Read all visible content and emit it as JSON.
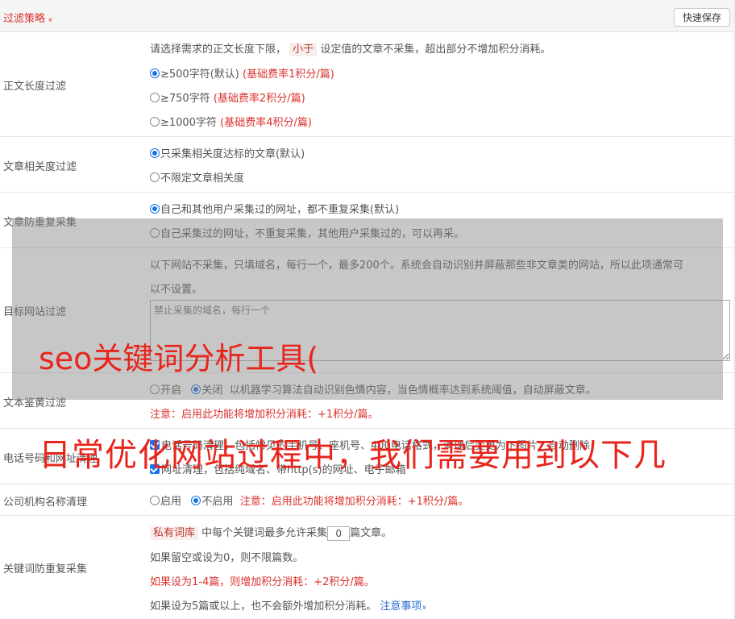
{
  "header": {
    "title": "过滤策略",
    "chevron": "»",
    "save_label": "快速保存"
  },
  "length_filter": {
    "label": "正文长度过滤",
    "desc_pre": "请选择需求的正文长度下限，",
    "desc_tag": "小于",
    "desc_post": "设定值的文章不采集，超出部分不增加积分消耗。",
    "options": [
      {
        "text": "≥500字符(默认)",
        "rate": "(基础费率1积分/篇)"
      },
      {
        "text": "≥750字符",
        "rate": "(基础费率2积分/篇)"
      },
      {
        "text": "≥1000字符",
        "rate": "(基础费率4积分/篇)"
      }
    ]
  },
  "relevance": {
    "label": "文章相关度过滤",
    "options": [
      "只采集相关度达标的文章(默认)",
      "不限定文章相关度"
    ]
  },
  "dedupe": {
    "label": "文章防重复采集",
    "options": [
      "自己和其他用户采集过的网址，都不重复采集(默认)",
      "自己采集过的网址，不重复采集，其他用户采集过的，可以再采。"
    ]
  },
  "site_filter": {
    "label": "目标网站过滤",
    "desc1": "以下网站不采集，只填域名，每行一个，最多200个。系统会自动识别并屏蔽那些非文章类的网站，所以此项通常可",
    "desc2": "以不设置。",
    "placeholder": "禁止采集的域名，每行一个"
  },
  "porn": {
    "label": "文本鉴黄过滤",
    "on": "开启",
    "off": "关闭",
    "desc": "以机器学习算法自动识别色情内容，当色情概率达到系统阈值，自动屏蔽文章。",
    "note": "注意：启用此功能将增加积分消耗：+1积分/篇。"
  },
  "phone": {
    "label": "电话号码和网址清理",
    "opt1": "电话号码清理，包括常见的手机号、座机号、400电话格式，清理后变更为下图片：自动删除",
    "opt2": "网址清理，包括纯域名、带http(s)的网址、电子邮箱"
  },
  "company": {
    "label": "公司机构名称清理",
    "on": "启用",
    "off": "不启用",
    "note": "注意：启用此功能将增加积分消耗：+1积分/篇。"
  },
  "keyword": {
    "label": "关键词防重复采集",
    "tag": "私有词库",
    "desc_mid": "中每个关键词最多允许采集",
    "value": "0",
    "desc_end": "篇文章。",
    "line2": "如果留空或设为0，则不限篇数。",
    "line3": "如果设为1-4篇，则增加积分消耗：+2积分/篇。",
    "line4": "如果设为5篇或以上，也不会额外增加积分消耗。",
    "link": "注意事项",
    "link_chev": "»"
  },
  "overlay": {
    "text1": "seo关键词分析工具(",
    "text2": "日常优化网站过程中，我们需要用到以下几"
  }
}
